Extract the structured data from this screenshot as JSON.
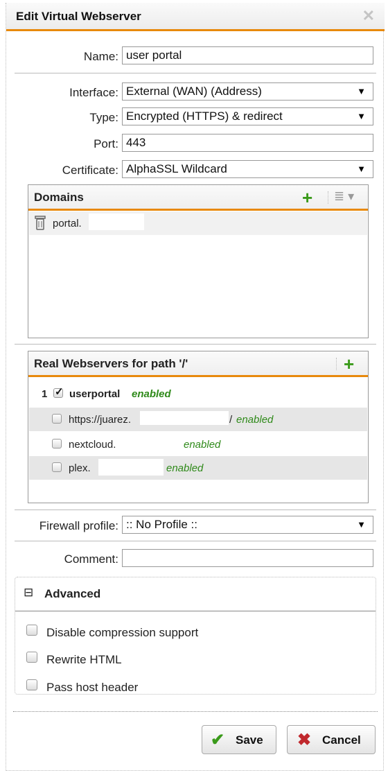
{
  "dialog": {
    "title": "Edit Virtual Webserver",
    "close_glyph": "✕"
  },
  "form": {
    "name_label": "Name:",
    "name_value": "user portal",
    "interface_label": "Interface:",
    "interface_value": "External (WAN) (Address)",
    "type_label": "Type:",
    "type_value": "Encrypted (HTTPS) & redirect",
    "port_label": "Port:",
    "port_value": "443",
    "certificate_label": "Certificate:",
    "certificate_value": "AlphaSSL Wildcard",
    "firewall_label": "Firewall profile:",
    "firewall_value": ":: No Profile ::",
    "comment_label": "Comment:",
    "comment_value": ""
  },
  "domains": {
    "title": "Domains",
    "items": [
      "portal."
    ]
  },
  "webservers": {
    "title": "Real Webservers for path '/'",
    "group_index": "1",
    "group_name": "userportal",
    "group_status": "enabled",
    "items": [
      {
        "text": "https://juarez.",
        "suffix": "/",
        "status": "enabled"
      },
      {
        "text": "nextcloud.",
        "suffix": "",
        "status": "enabled"
      },
      {
        "text": "plex.",
        "suffix": "",
        "status": "enabled"
      }
    ]
  },
  "advanced": {
    "toggle_glyph": "⊟",
    "title": "Advanced",
    "options": [
      "Disable compression support",
      "Rewrite HTML",
      "Pass host header"
    ]
  },
  "buttons": {
    "save": "Save",
    "cancel": "Cancel"
  },
  "colors": {
    "accent": "#e8890c",
    "enabled_green": "#2f8a1a",
    "add_green": "#3a9a1a",
    "cancel_red": "#c0282d"
  },
  "icons": [
    "close-icon",
    "trash-icon",
    "add-icon",
    "list-menu-icon",
    "check-icon",
    "cross-icon"
  ]
}
